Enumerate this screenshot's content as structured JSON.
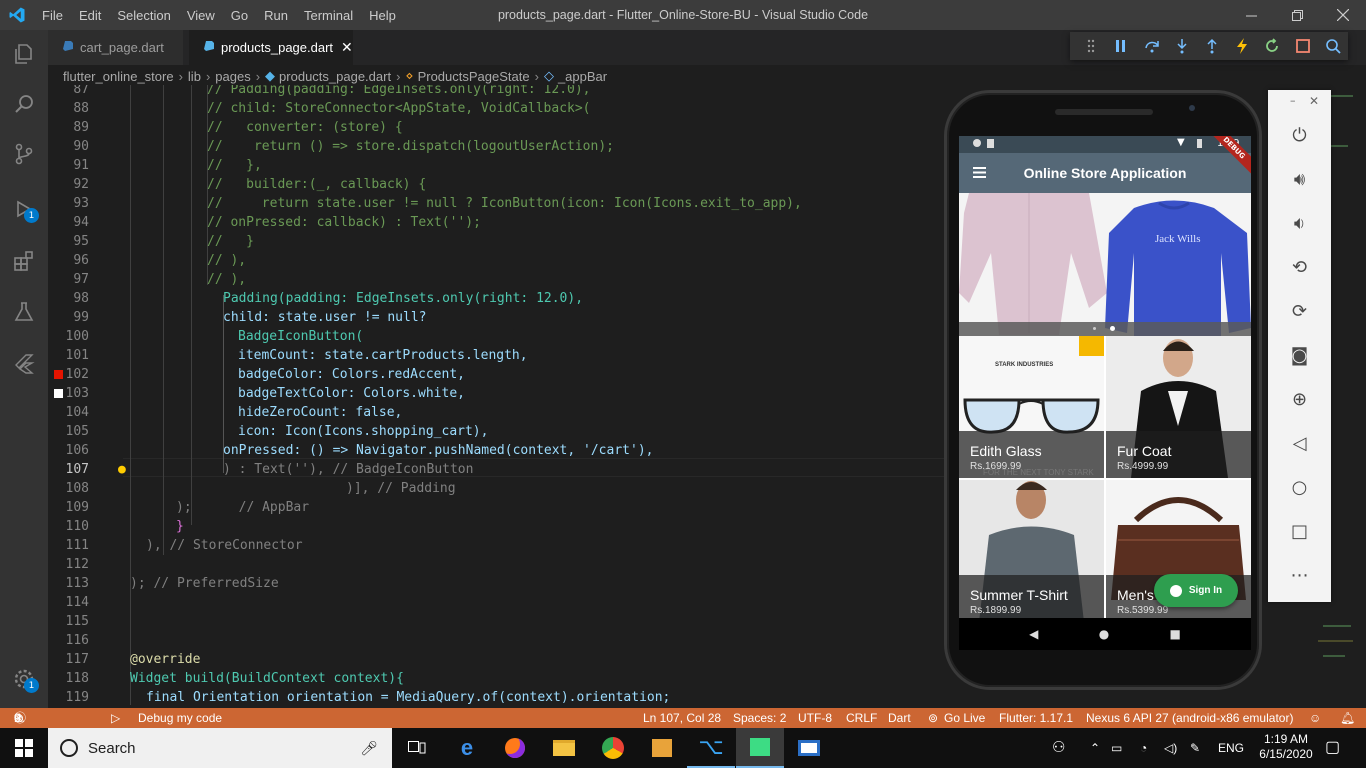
{
  "window": {
    "title": "products_page.dart - Flutter_Online-Store-BU - Visual Studio Code",
    "menu": [
      "File",
      "Edit",
      "Selection",
      "View",
      "Go",
      "Run",
      "Terminal",
      "Help"
    ]
  },
  "tabs": [
    {
      "label": "cart_page.dart",
      "active": false
    },
    {
      "label": "products_page.dart",
      "active": true
    }
  ],
  "breadcrumb": [
    "flutter_online_store",
    "lib",
    "pages",
    "products_page.dart",
    "ProductsPageState",
    "_appBar"
  ],
  "activity_badges": {
    "debug": "1",
    "settings": "1"
  },
  "editor": {
    "current_line": "107",
    "lines": [
      {
        "n": "87",
        "text": "// Padding(padding: EdgeInsets.only(right: 12.0),"
      },
      {
        "n": "88",
        "text": "// child: StoreConnector<AppState, VoidCallback>("
      },
      {
        "n": "89",
        "text": "//   converter: (store) {"
      },
      {
        "n": "90",
        "text": "//    return () => store.dispatch(logoutUserAction);"
      },
      {
        "n": "91",
        "text": "//   },"
      },
      {
        "n": "92",
        "text": "//   builder:(_, callback) {"
      },
      {
        "n": "93",
        "text": "//     return state.user != null ? IconButton(icon: Icon(Icons.exit_to_app),"
      },
      {
        "n": "94",
        "text": "// onPressed: callback) : Text('');"
      },
      {
        "n": "95",
        "text": "//   }"
      },
      {
        "n": "96",
        "text": "// ),"
      },
      {
        "n": "97",
        "text": "// ),"
      },
      {
        "n": "98",
        "text": "Padding(padding: EdgeInsets.only(right: 12.0),"
      },
      {
        "n": "99",
        "text": "child: state.user != null?"
      },
      {
        "n": "100",
        "text": "BadgeIconButton("
      },
      {
        "n": "101",
        "text": "itemCount: state.cartProducts.length,"
      },
      {
        "n": "102",
        "text": "badgeColor: Colors.redAccent,"
      },
      {
        "n": "103",
        "text": "badgeTextColor: Colors.white,"
      },
      {
        "n": "104",
        "text": "hideZeroCount: false,"
      },
      {
        "n": "105",
        "text": "icon: Icon(Icons.shopping_cart),"
      },
      {
        "n": "106",
        "text": "onPressed: () => Navigator.pushNamed(context, '/cart'),"
      },
      {
        "n": "107",
        "text": ") : Text(''), // BadgeIconButton"
      },
      {
        "n": "108",
        "text": ")], // Padding"
      },
      {
        "n": "109",
        "text": ");      // AppBar"
      },
      {
        "n": "110",
        "text": "}"
      },
      {
        "n": "111",
        "text": "), // StoreConnector"
      },
      {
        "n": "112",
        "text": ""
      },
      {
        "n": "113",
        "text": "); // PreferredSize"
      },
      {
        "n": "114",
        "text": ""
      },
      {
        "n": "115",
        "text": ""
      },
      {
        "n": "116",
        "text": ""
      },
      {
        "n": "117",
        "text": "@override"
      },
      {
        "n": "118",
        "text": "Widget build(BuildContext context){"
      },
      {
        "n": "119",
        "text": "final Orientation orientation = MediaQuery.of(context).orientation;"
      }
    ]
  },
  "statusbar": {
    "errors": "0",
    "warnings": "0",
    "info": "9",
    "debug_config": "Debug my code",
    "cursor": "Ln 107, Col 28",
    "spaces": "Spaces: 2",
    "encoding": "UTF-8",
    "eol": "CRLF",
    "language": "Dart",
    "golive": "Go Live",
    "flutter": "Flutter: 1.17.1",
    "device": "Nexus 6 API 27 (android-x86 emulator)"
  },
  "taskbar": {
    "search_placeholder": "Search",
    "lang": "ENG",
    "time": "1:19 AM",
    "date": "6/15/2020"
  },
  "emulator": {
    "status_time": "1:19",
    "debug_banner": "DEBUG",
    "app_title": "Online Store Application",
    "banner_brand": "Jack Wills",
    "products": [
      {
        "name": "Edith Glass",
        "price": "Rs.1699.99",
        "brand": "STARK INDUSTRIES",
        "caption": "FOR THE NEXT TONY STARK"
      },
      {
        "name": "Fur Coat",
        "price": "Rs.4999.99"
      },
      {
        "name": "Summer T-Shirt",
        "price": "Rs.1899.99"
      },
      {
        "name": "Men's",
        "price": "Rs.5399.99"
      }
    ],
    "signin_label": "Sign In"
  }
}
